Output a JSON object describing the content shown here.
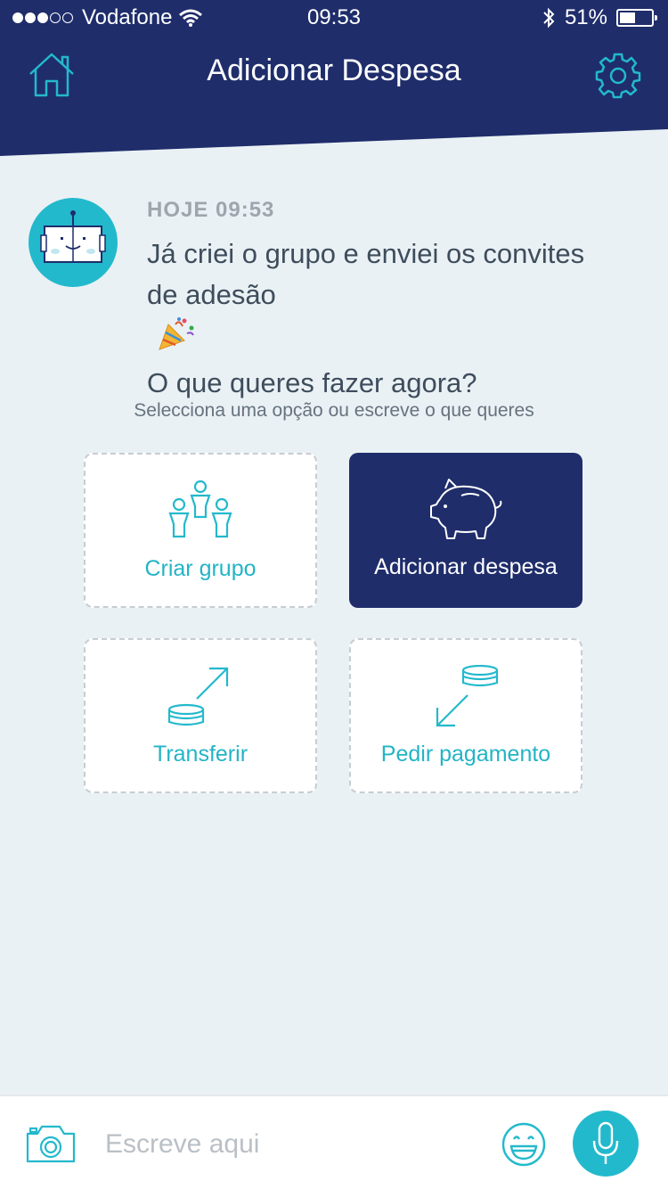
{
  "status_bar": {
    "carrier": "Vodafone",
    "time": "09:53",
    "battery": "51%",
    "battery_level": 0.51,
    "signal_bars": 3,
    "signal_total": 5
  },
  "nav": {
    "title": "Adicionar Despesa",
    "left_icon": "home-icon",
    "right_icon": "gear-icon"
  },
  "message": {
    "timestamp": "HOJE 09:53",
    "lines": [
      "Já criei o grupo e enviei os convites",
      "de adesão",
      "O que queres fazer agora?"
    ],
    "emoji_icon": "party-popper-icon"
  },
  "prompt": "Selecciona uma opção ou escreve o que queres",
  "options": [
    {
      "label": "Criar grupo",
      "icon": "people-icon",
      "selected": false
    },
    {
      "label": "Adicionar despesa",
      "icon": "piggy-bank-icon",
      "selected": true
    },
    {
      "label": "Transferir",
      "icon": "transfer-icon",
      "selected": false
    },
    {
      "label": "Pedir pagamento",
      "icon": "request-payment-icon",
      "selected": false
    }
  ],
  "input_bar": {
    "placeholder": "Escreve aqui",
    "camera_icon": "camera-icon",
    "emoji_icon": "smiley-icon",
    "mic_icon": "microphone-icon"
  },
  "colors": {
    "navy": "#1f2d6b",
    "teal": "#23b9cc",
    "background": "#eaf1f5",
    "text": "#3e4d5c"
  }
}
